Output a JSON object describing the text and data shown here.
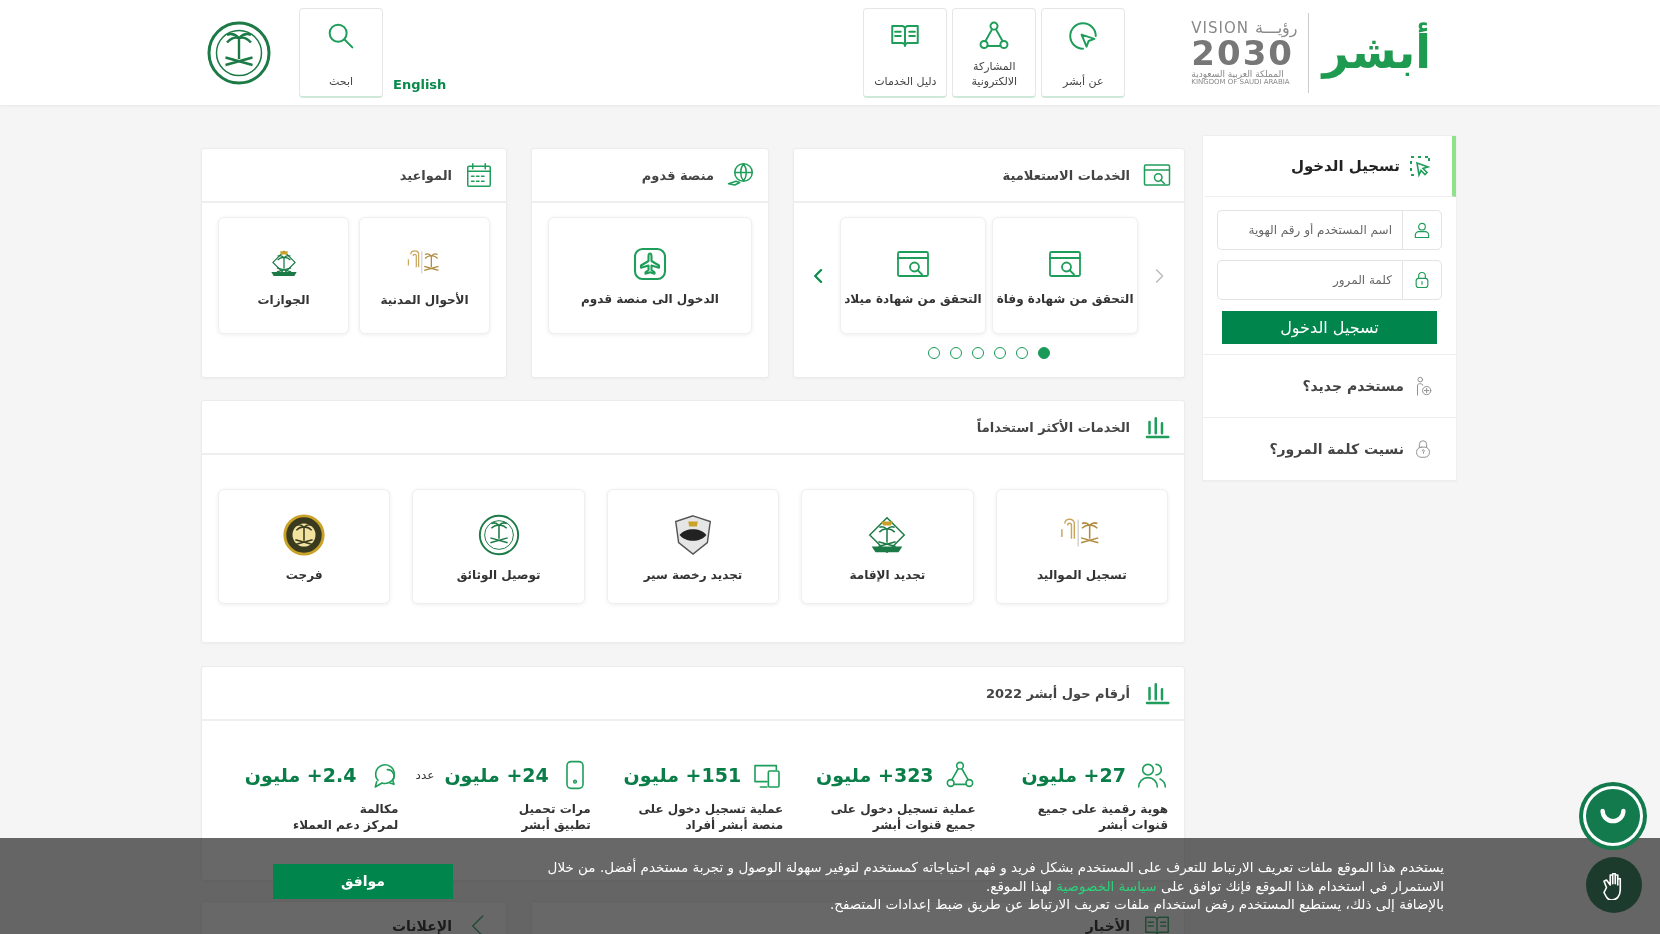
{
  "header": {
    "logo": "أبشر",
    "vision": {
      "word": "VISION",
      "arabic": "رؤيـــة",
      "year": "2030",
      "country_ar": "المملكة العربية السعودية",
      "country_en": "KINGDOM OF SAUDI ARABIA"
    },
    "nav": [
      {
        "label": "عن أبشر"
      },
      {
        "label": "المشاركة الالكترونية"
      },
      {
        "label": "دليل الخدمات"
      }
    ],
    "language": "English",
    "search": "ابحث"
  },
  "login": {
    "title": "تسجيل الدخول",
    "username_placeholder": "اسم المستخدم أو رقم الهوية",
    "password_placeholder": "كلمة المرور",
    "button": "تسجيل الدخول",
    "links": [
      {
        "label": "مستخدم جديد؟"
      },
      {
        "label": "نسيت كلمة المرور؟"
      }
    ]
  },
  "cards": [
    {
      "title": "الخدمات الاستعلامية",
      "kind": "carousel",
      "tiles": [
        {
          "label": "التحقق من شهادة وفاة"
        },
        {
          "label": "التحقق من شهادة ميلاد"
        }
      ],
      "dots": [
        {
          "selected": true
        },
        {
          "selected": false
        },
        {
          "selected": false
        },
        {
          "selected": false
        },
        {
          "selected": false
        },
        {
          "selected": false
        }
      ]
    },
    {
      "title": "منصة قدوم",
      "kind": "grid",
      "tiles": [
        {
          "label": "الدخول الى منصة قدوم"
        }
      ]
    },
    {
      "title": "المواعيد",
      "kind": "grid",
      "tiles": [
        {
          "label": "الأحوال المدنية"
        },
        {
          "label": "الجوازات"
        }
      ]
    }
  ],
  "most_used": {
    "title": "الخدمات الأكثر استخداماً",
    "tiles": [
      {
        "label": "تسجيل المواليد"
      },
      {
        "label": "تجديد الإقامة"
      },
      {
        "label": "تجديد رخصة سير"
      },
      {
        "label": "توصيل الوثائق"
      },
      {
        "label": "فرجت"
      }
    ]
  },
  "stats": {
    "title": "أرقام حول أبشر 2022",
    "items": [
      {
        "value": "27+ مليون",
        "line_1": "هوية رقمية على جميع",
        "line_2": "قنوات أبشر"
      },
      {
        "value": "323+ مليون",
        "line_1": "عملية تسجيل دخول على",
        "line_2": "جميع قنوات أبشر"
      },
      {
        "value": "151+ مليون",
        "line_1": "عملية تسجيل دخول على",
        "line_2": "منصة أبشر أفراد"
      },
      {
        "value": "24+ مليون",
        "suffix": "عدد",
        "line_1": "مرات تحميل",
        "line_2": "تطبيق أبشر"
      },
      {
        "value": "2.4+ مليون",
        "line_1": "مكالمة",
        "line_2": "لمركز دعم العملاء"
      }
    ]
  },
  "bottom_panels": [
    {
      "title": "الأخبار"
    },
    {
      "title": "الإعلانات"
    }
  ],
  "cookie": {
    "text_1": "يستخدم هذا الموقع ملفات تعريف الارتباط للتعرف على المستخدم بشكل فريد و فهم احتياجاته كمستخدم لتوفير سهولة الوصول و تجربة مستخدم أفضل. من خلال الاستمرار في استخدام هذا الموقع فإنك توافق على",
    "link": "سياسة الخصوصية",
    "text_2": "لهذا الموقع.",
    "text_3": "بالإضافة إلى ذلك، يستطيع المستخدم رفض استخدام ملفات تعريف الارتباط عن طريق ضبط إعدادات المتصفح.",
    "button": "موافق"
  }
}
